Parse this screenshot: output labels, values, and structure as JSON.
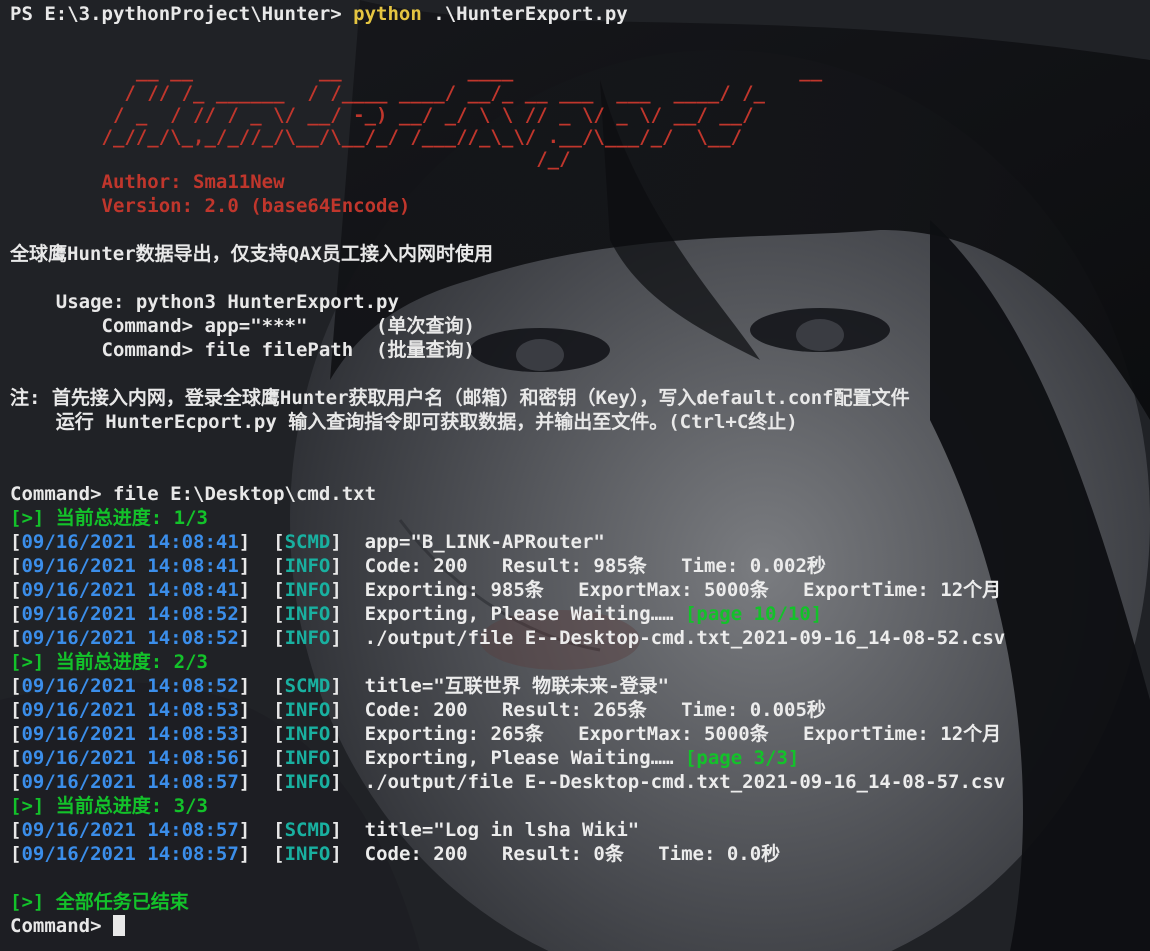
{
  "prompt_line": {
    "prompt": "PS E:\\3.pythonProject\\Hunter> ",
    "cmd": "python",
    "args": " .\\HunterExport.py"
  },
  "banner": [
    "           __ __           __           ____                         __",
    "          / // /_ ______  / /____ ____/ __/_ __ ___  ___  ____/ /_",
    "         / _  / // / _ \\/ __/ -_) __/ _/ \\ \\ // _ \\/ _ \\/ __/ __/",
    "        /_//_/\\_,_/_//_/\\__/\\__/_/ /___//_\\_\\/ .__/\\___/_/  \\__/",
    "                                              /_/"
  ],
  "author": "        Author: Sma11New",
  "version": "        Version: 2.0 (base64Encode)",
  "description": "全球鹰Hunter数据导出，仅支持QAX员工接入内网时使用",
  "usage": [
    "    Usage: python3 HunterExport.py",
    "        Command> app=\"***\"      (单次查询)",
    "        Command> file filePath  (批量查询)"
  ],
  "notes": [
    "注: 首先接入内网，登录全球鹰Hunter获取用户名（邮箱）和密钥（Key），写入default.conf配置文件",
    "    运行 HunterEcport.py 输入查询指令即可获取数据，并输出至文件。(Ctrl+C终止)"
  ],
  "command_line": "Command> file E:\\Desktop\\cmd.txt",
  "log": [
    {
      "type": "progress",
      "text": "[>] 当前总进度: 1/3"
    },
    {
      "type": "entry",
      "time": "09/16/2021 14:08:41",
      "level": "SCMD",
      "msg": "app=\"B_LINK-APRouter\""
    },
    {
      "type": "entry",
      "time": "09/16/2021 14:08:41",
      "level": "INFO",
      "msg": "Code: 200   Result: 985条   Time: 0.002秒"
    },
    {
      "type": "entry",
      "time": "09/16/2021 14:08:41",
      "level": "INFO",
      "msg": "Exporting: 985条   ExportMax: 5000条   ExportTime: 12个月"
    },
    {
      "type": "entry",
      "time": "09/16/2021 14:08:52",
      "level": "INFO",
      "msg": "Exporting, Please Waiting……",
      "extra": "[page 10/10]"
    },
    {
      "type": "entry",
      "time": "09/16/2021 14:08:52",
      "level": "INFO",
      "msg": "./output/file E--Desktop-cmd.txt_2021-09-16_14-08-52.csv"
    },
    {
      "type": "progress",
      "text": "[>] 当前总进度: 2/3"
    },
    {
      "type": "entry",
      "time": "09/16/2021 14:08:52",
      "level": "SCMD",
      "msg": "title=\"互联世界 物联未来-登录\""
    },
    {
      "type": "entry",
      "time": "09/16/2021 14:08:53",
      "level": "INFO",
      "msg": "Code: 200   Result: 265条   Time: 0.005秒"
    },
    {
      "type": "entry",
      "time": "09/16/2021 14:08:53",
      "level": "INFO",
      "msg": "Exporting: 265条   ExportMax: 5000条   ExportTime: 12个月"
    },
    {
      "type": "entry",
      "time": "09/16/2021 14:08:56",
      "level": "INFO",
      "msg": "Exporting, Please Waiting……",
      "extra": "[page 3/3]"
    },
    {
      "type": "entry",
      "time": "09/16/2021 14:08:57",
      "level": "INFO",
      "msg": "./output/file E--Desktop-cmd.txt_2021-09-16_14-08-57.csv"
    },
    {
      "type": "progress",
      "text": "[>] 当前总进度: 3/3"
    },
    {
      "type": "entry",
      "time": "09/16/2021 14:08:57",
      "level": "SCMD",
      "msg": "title=\"Log in lsha Wiki\""
    },
    {
      "type": "entry",
      "time": "09/16/2021 14:08:57",
      "level": "INFO",
      "msg": "Code: 200   Result: 0条   Time: 0.0秒"
    }
  ],
  "finished": "[>] 全部任务已结束",
  "final_prompt": "Command> ",
  "colors": {
    "banner": "#c0362c",
    "progress": "#13c22a",
    "timestamp": "#3b8eea",
    "level": "#19b0a0",
    "command_highlight": "#e5c541"
  }
}
